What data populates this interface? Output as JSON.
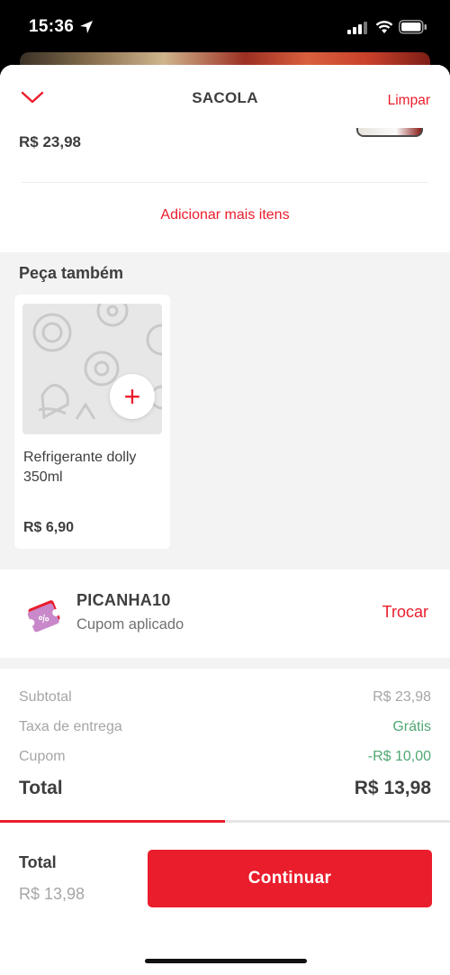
{
  "status_bar": {
    "time": "15:36"
  },
  "header": {
    "title": "SACOLA",
    "clear_label": "Limpar"
  },
  "cart_item": {
    "price": "R$ 23,98"
  },
  "add_more_label": "Adicionar mais itens",
  "also_order": {
    "title": "Peça também",
    "products": [
      {
        "name": "Refrigerante dolly 350ml",
        "price": "R$ 6,90",
        "add_icon": "plus-icon"
      }
    ]
  },
  "coupon": {
    "code": "PICANHA10",
    "status": "Cupom aplicado",
    "change_label": "Trocar",
    "icon": "coupon-ticket-icon"
  },
  "summary": {
    "subtotal_label": "Subtotal",
    "subtotal_value": "R$ 23,98",
    "delivery_label": "Taxa de entrega",
    "delivery_value": "Grátis",
    "coupon_label": "Cupom",
    "coupon_value": "-R$ 10,00",
    "total_label": "Total",
    "total_value": "R$ 13,98"
  },
  "progress": {
    "fraction": 0.5
  },
  "footer": {
    "total_label": "Total",
    "total_value": "R$ 13,98",
    "continue_label": "Continuar"
  },
  "colors": {
    "accent": "#ea1d2c",
    "success": "#50a773",
    "text": "#3e3e3e",
    "muted": "#a6a6a6",
    "section_bg": "#f3f3f3"
  }
}
